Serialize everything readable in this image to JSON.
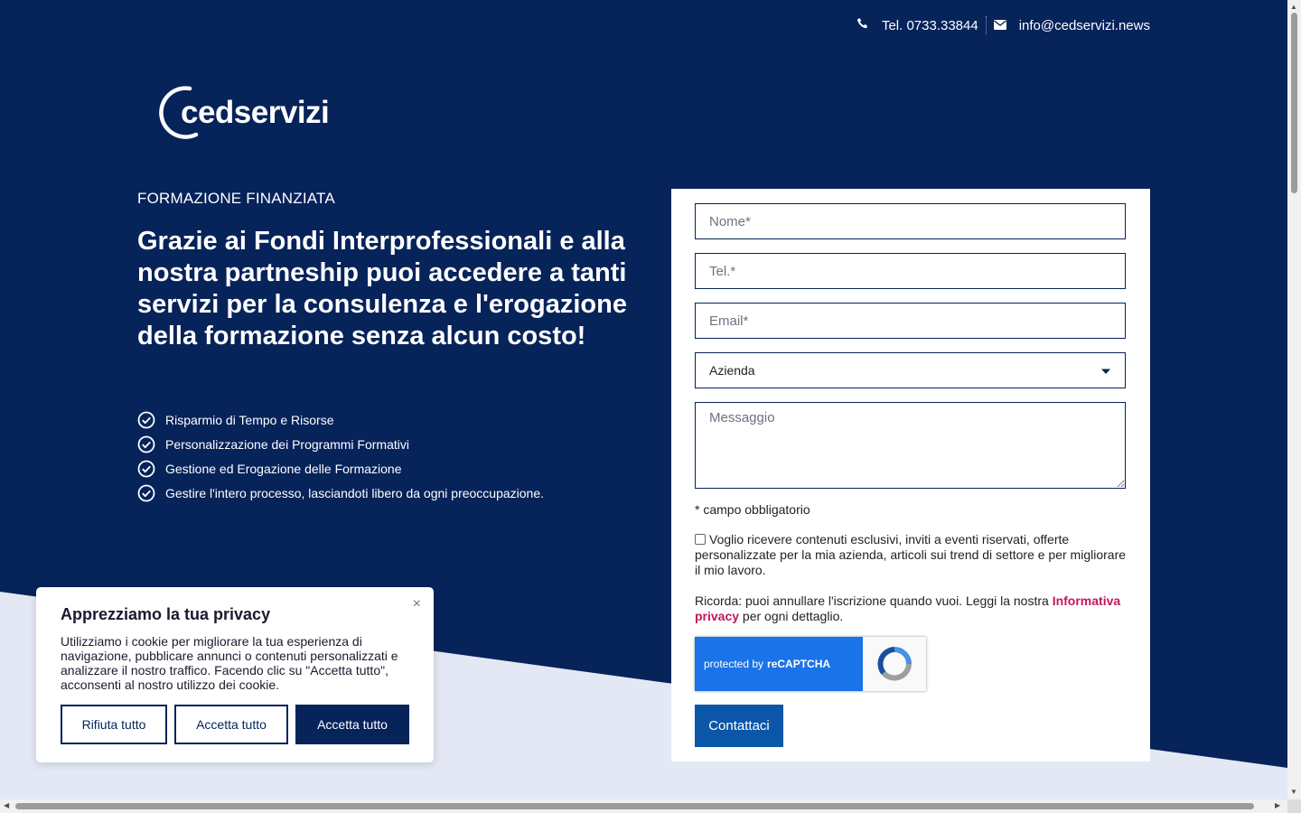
{
  "colors": {
    "navy": "#06235a",
    "light_band": "#e3e8f4",
    "button_blue": "#0b56a8",
    "link_pink": "#c2185b",
    "recaptcha_blue": "#1a73e8"
  },
  "topbar": {
    "phone_icon": "phone-icon",
    "phone": "Tel. 0733.33844",
    "email_icon": "envelope-icon",
    "email": "info@cedservizi.news"
  },
  "logo": {
    "text": "cedservizi"
  },
  "hero": {
    "eyebrow": "FORMAZIONE FINANZIATA",
    "headline": "Grazie ai Fondi Interprofessionali e alla nostra partneship puoi accedere a tanti servizi per la consulenza e l'erogazione della formazione senza alcun costo!",
    "features": [
      "Risparmio di Tempo e Risorse",
      "Personalizzazione dei Programmi Formativi",
      "Gestione ed Erogazione delle Formazione",
      "Gestire l'intero processo, lasciandoti libero da ogni preoccupazione."
    ]
  },
  "form": {
    "name_placeholder": "Nome*",
    "phone_placeholder": "Tel.*",
    "email_placeholder": "Email*",
    "select_value": "Azienda",
    "message_placeholder": "Messaggio",
    "required_note": "* campo obbligatorio",
    "consent_text": "Voglio ricevere contenuti esclusivi, inviti a eventi riservati, offerte personalizzate per la mia azienda, articoli sui trend di settore e per migliorare il mio lavoro.",
    "remember_prefix": "Ricorda: puoi annullare l'iscrizione quando vuoi. Leggi la nostra ",
    "remember_link": "Informativa privacy",
    "remember_suffix": " per ogni dettaglio.",
    "recaptcha_prefix": "protected by",
    "recaptcha_brand": "reCAPTCHA",
    "submit_label": "Contattaci"
  },
  "cookie": {
    "title": "Apprezziamo la tua privacy",
    "body": "Utilizziamo i cookie per migliorare la tua esperienza di navigazione, pubblicare annunci o contenuti personalizzati e analizzare il nostro traffico. Facendo clic su \"Accetta tutto\", acconsenti al nostro utilizzo dei cookie.",
    "close": "×",
    "reject_label": "Rifiuta tutto",
    "accept_label": "Accetta tutto",
    "accept_all_label": "Accetta tutto"
  }
}
